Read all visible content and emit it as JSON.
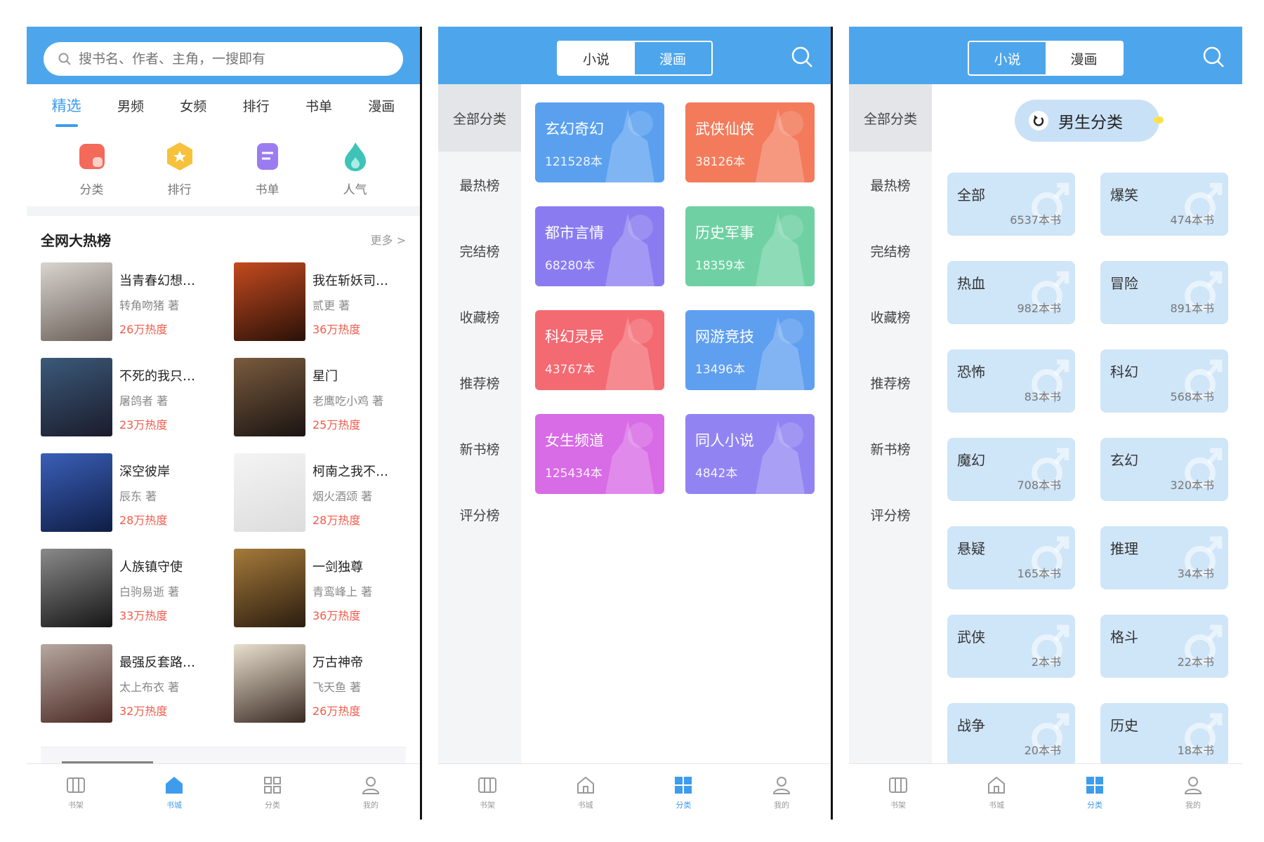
{
  "home": {
    "search_placeholder": "搜书名、作者、主角，一搜即有",
    "tabs": [
      "精选",
      "男频",
      "女频",
      "排行",
      "书单",
      "漫画"
    ],
    "quick_links": [
      {
        "label": "分类",
        "color": "#f36a5a"
      },
      {
        "label": "排行",
        "color": "#f8c13a"
      },
      {
        "label": "书单",
        "color": "#9b7bf0"
      },
      {
        "label": "人气",
        "color": "#3ec3b6"
      }
    ],
    "hot_title": "全网大热榜",
    "more_label": "更多 >",
    "books": [
      {
        "title": "当青春幻想…",
        "author": "转角吻猪 著",
        "heat": "26万热度",
        "c1": "#d9d4cf",
        "c2": "#6a5f58"
      },
      {
        "title": "我在斩妖司…",
        "author": "贰更 著",
        "heat": "36万热度",
        "c1": "#c44a1f",
        "c2": "#2a1108"
      },
      {
        "title": "不死的我只…",
        "author": "屠鸽者 著",
        "heat": "23万热度",
        "c1": "#3b5a7a",
        "c2": "#1b1b2b"
      },
      {
        "title": "星门",
        "author": "老鹰吃小鸡 著",
        "heat": "25万热度",
        "c1": "#7a5b3e",
        "c2": "#1a1412"
      },
      {
        "title": "深空彼岸",
        "author": "辰东 著",
        "heat": "28万热度",
        "c1": "#3a5fb8",
        "c2": "#0f1d45"
      },
      {
        "title": "柯南之我不…",
        "author": "烟火酒颂 著",
        "heat": "28万热度",
        "c1": "#f4f4f4",
        "c2": "#dcdcdc"
      },
      {
        "title": "人族镇守使",
        "author": "白驹易逝 著",
        "heat": "33万热度",
        "c1": "#8a8a8a",
        "c2": "#161616"
      },
      {
        "title": "一剑独尊",
        "author": "青鸾峰上 著",
        "heat": "36万热度",
        "c1": "#a57a3a",
        "c2": "#2b1d10"
      },
      {
        "title": "最强反套路…",
        "author": "太上布衣 著",
        "heat": "32万热度",
        "c1": "#b7a8a0",
        "c2": "#4b2a24"
      },
      {
        "title": "万古神帝",
        "author": "飞天鱼 著",
        "heat": "26万热度",
        "c1": "#e9e0cf",
        "c2": "#3a2a22"
      }
    ]
  },
  "nav": {
    "labels": [
      "书架",
      "书城",
      "分类",
      "我的"
    ]
  },
  "category": {
    "seg": [
      "小说",
      "漫画"
    ],
    "side": [
      "全部分类",
      "最热榜",
      "完结榜",
      "收藏榜",
      "推荐榜",
      "新书榜",
      "评分榜"
    ],
    "tiles": [
      {
        "name": "玄幻奇幻",
        "count": "121528本",
        "color": "#5aa0ef"
      },
      {
        "name": "武侠仙侠",
        "count": "38126本",
        "color": "#f37b5b"
      },
      {
        "name": "都市言情",
        "count": "68280本",
        "color": "#8a7cf0"
      },
      {
        "name": "历史军事",
        "count": "18359本",
        "color": "#6fd1a3"
      },
      {
        "name": "科幻灵异",
        "count": "43767本",
        "color": "#f46a72"
      },
      {
        "name": "网游竞技",
        "count": "13496本",
        "color": "#5f9ff0"
      },
      {
        "name": "女生频道",
        "count": "125434本",
        "color": "#d86be6"
      },
      {
        "name": "同人小说",
        "count": "4842本",
        "color": "#9184f2"
      }
    ]
  },
  "male": {
    "title": "男生分类",
    "items": [
      {
        "name": "全部",
        "count": "6537本书"
      },
      {
        "name": "爆笑",
        "count": "474本书"
      },
      {
        "name": "热血",
        "count": "982本书"
      },
      {
        "name": "冒险",
        "count": "891本书"
      },
      {
        "name": "恐怖",
        "count": "83本书"
      },
      {
        "name": "科幻",
        "count": "568本书"
      },
      {
        "name": "魔幻",
        "count": "708本书"
      },
      {
        "name": "玄幻",
        "count": "320本书"
      },
      {
        "name": "悬疑",
        "count": "165本书"
      },
      {
        "name": "推理",
        "count": "34本书"
      },
      {
        "name": "武侠",
        "count": "2本书"
      },
      {
        "name": "格斗",
        "count": "22本书"
      },
      {
        "name": "战争",
        "count": "20本书"
      },
      {
        "name": "历史",
        "count": "18本书"
      }
    ]
  },
  "colors": {
    "header_blue": "#4da6ec",
    "accent_blue": "#3d9cec",
    "heat_red": "#f25b4b"
  }
}
